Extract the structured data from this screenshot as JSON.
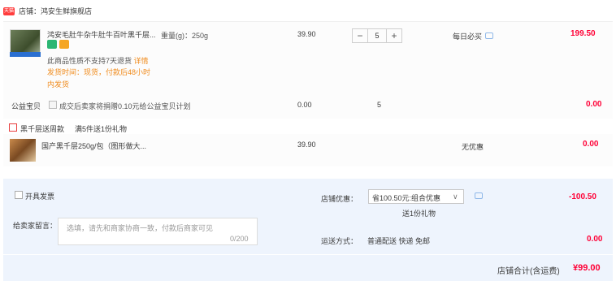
{
  "shop": {
    "badge": "天猫",
    "name": "店铺：鸿安生鲜旗舰店"
  },
  "item1": {
    "title": "鸿安毛肚牛杂牛肚牛百叶黑千层...",
    "spec": "重量(g)：250g",
    "price": "39.90",
    "qty": "5",
    "minus": "−",
    "plus": "+",
    "tag": "每日必买",
    "subtotal": "199.50",
    "note": "此商品性质不支持7天退货",
    "note_link": "详情",
    "ship_line1": "发货时间：现货，付款后48小时",
    "ship_line2": "内发货"
  },
  "welfare": {
    "label": "公益宝贝",
    "desc": "成交后卖家将捐赠0.10元给公益宝贝计划",
    "price": "0.00",
    "qty": "5",
    "subtotal": "0.00"
  },
  "gift": {
    "label": "黑千层送周款",
    "note": "满5件送1份礼物",
    "title": "国产黑千层250g/包（图形做大...",
    "price": "39.90",
    "discount": "无优惠",
    "subtotal": "0.00"
  },
  "footer": {
    "invoice_label": "开具发票",
    "message_label": "给卖家留言：",
    "message_placeholder": "选填，请先和商家协商一致，付款后商家可见",
    "message_count": "0/200",
    "promo_label": "店铺优惠：",
    "promo_value": "省100.50元:组合优惠",
    "promo_sub": "送1份礼物",
    "promo_amount": "-100.50",
    "ship_label": "运送方式：",
    "ship_value": "普通配送 快递 免邮",
    "ship_amount": "0.00",
    "total_label": "店铺合计(含运费)",
    "total_amount": "¥99.00"
  },
  "colors": {
    "accent": "#ff0036",
    "orange": "#f08c1e",
    "footer_bg": "#eef4fd"
  }
}
